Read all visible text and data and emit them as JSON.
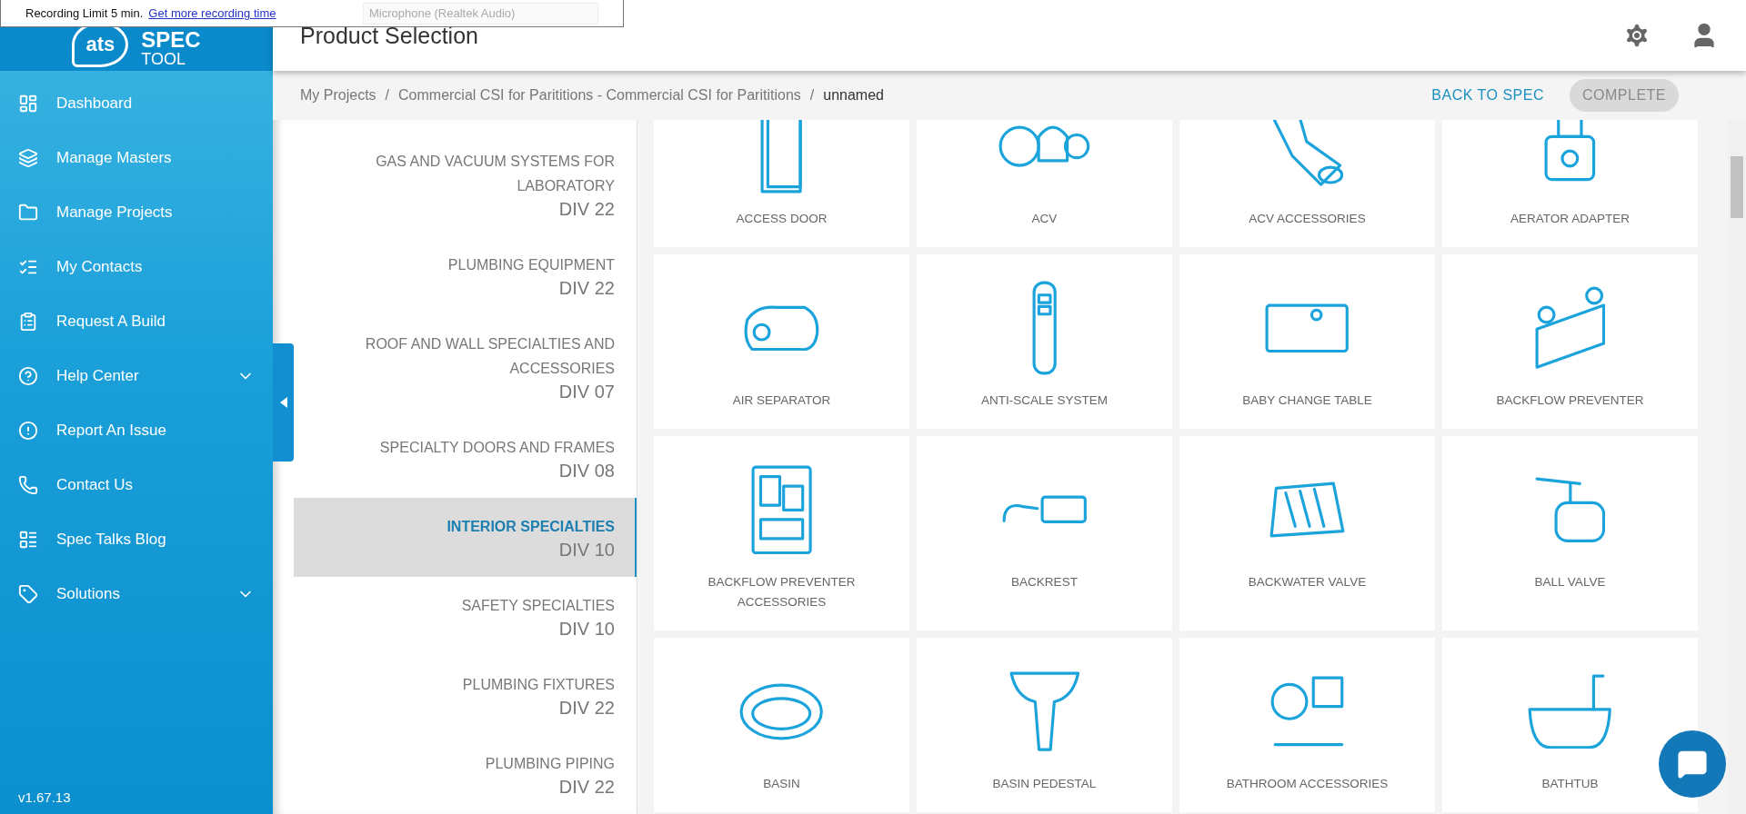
{
  "recorder": {
    "limit_text": "Recording Limit 5 min.",
    "link": "Get more recording time",
    "microphone": "Microphone (Realtek Audio)"
  },
  "logo": {
    "mark": "ats",
    "title": "SPEC",
    "subtitle": "TOOL"
  },
  "sidebar": {
    "items": [
      {
        "label": "Dashboard",
        "expandable": false
      },
      {
        "label": "Manage Masters",
        "expandable": false
      },
      {
        "label": "Manage Projects",
        "expandable": false
      },
      {
        "label": "My Contacts",
        "expandable": false
      },
      {
        "label": "Request A Build",
        "expandable": false
      },
      {
        "label": "Help Center",
        "expandable": true
      },
      {
        "label": "Report An Issue",
        "expandable": false
      },
      {
        "label": "Contact Us",
        "expandable": false
      },
      {
        "label": "Spec Talks Blog",
        "expandable": false
      },
      {
        "label": "Solutions",
        "expandable": true
      }
    ],
    "version": "v1.67.13"
  },
  "header": {
    "title": "Product Selection"
  },
  "breadcrumb": [
    {
      "label": "My Projects"
    },
    {
      "separator": "/",
      "label": "Commercial CSI for Parititions - Commercial CSI for Parititions"
    },
    {
      "separator": "/",
      "label": "unnamed"
    }
  ],
  "actions": {
    "back": "BACK TO SPEC",
    "complete": {
      "label": "COMPLETE",
      "disabled": true
    }
  },
  "categories": [
    {
      "name": "GAS AND VACUUM SYSTEMS FOR LABORATORY",
      "division": "DIV 22",
      "selected": false
    },
    {
      "name": "PLUMBING EQUIPMENT",
      "division": "DIV 22",
      "selected": false
    },
    {
      "name": "ROOF AND WALL SPECIALTIES AND ACCESSORIES",
      "division": "DIV 07",
      "selected": false
    },
    {
      "name": "SPECIALTY DOORS AND FRAMES",
      "division": "DIV 08",
      "selected": false
    },
    {
      "name": "INTERIOR SPECIALTIES",
      "division": "DIV 10",
      "selected": true
    },
    {
      "name": "SAFETY SPECIALTIES",
      "division": "DIV 10",
      "selected": false
    },
    {
      "name": "PLUMBING FIXTURES",
      "division": "DIV 22",
      "selected": false
    },
    {
      "name": "PLUMBING PIPING",
      "division": "DIV 22",
      "selected": false
    }
  ],
  "products": [
    {
      "name": "ACCESS DOOR"
    },
    {
      "name": "ACV"
    },
    {
      "name": "ACV ACCESSORIES"
    },
    {
      "name": "AERATOR ADAPTER"
    },
    {
      "name": "AIR SEPARATOR"
    },
    {
      "name": "ANTI-SCALE SYSTEM"
    },
    {
      "name": "BABY CHANGE TABLE"
    },
    {
      "name": "BACKFLOW PREVENTER"
    },
    {
      "name": "BACKFLOW PREVENTER ACCESSORIES"
    },
    {
      "name": "BACKREST"
    },
    {
      "name": "BACKWATER VALVE"
    },
    {
      "name": "BALL VALVE"
    },
    {
      "name": "BASIN"
    },
    {
      "name": "BASIN PEDESTAL"
    },
    {
      "name": "BATHROOM ACCESSORIES"
    },
    {
      "name": "BATHTUB"
    }
  ]
}
